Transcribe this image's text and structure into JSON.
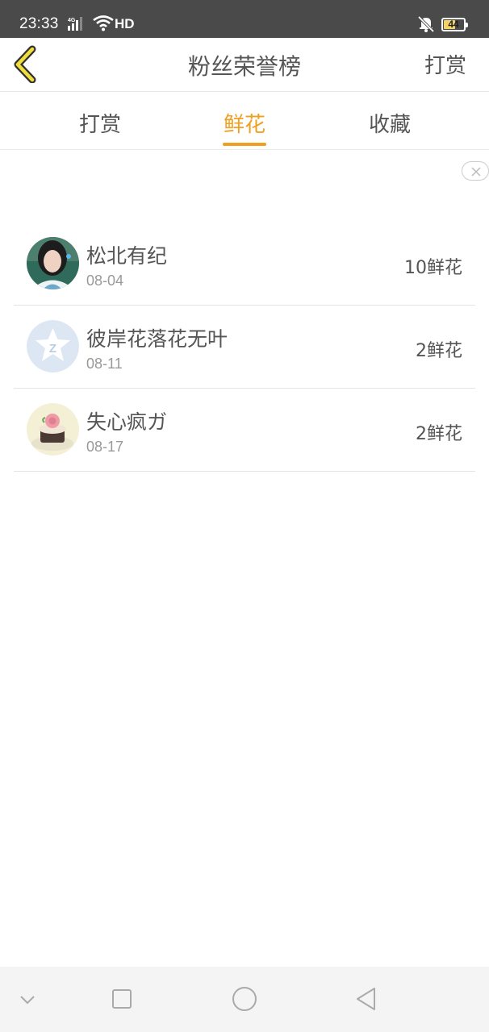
{
  "status_bar": {
    "time": "23:33",
    "network": "4G",
    "hd_label": "HD",
    "battery": "44",
    "icons": [
      "signal-icon",
      "wifi-icon",
      "mute-bell-icon",
      "battery-icon"
    ]
  },
  "header": {
    "back_icon": "chevron-left-icon",
    "title": "粉丝荣誉榜",
    "action_label": "打赏"
  },
  "tabs": [
    {
      "label": "打赏",
      "active": false
    },
    {
      "label": "鲜花",
      "active": true
    },
    {
      "label": "收藏",
      "active": false
    }
  ],
  "accent_color": "#f0a020",
  "ad": {
    "close_icon": "close-icon"
  },
  "fans": [
    {
      "name": "松北有纪",
      "date": "08-04",
      "amount": "10鲜花",
      "avatar": "photo-avatar"
    },
    {
      "name": "彼岸花落花无叶",
      "date": "08-11",
      "amount": "2鲜花",
      "avatar": "default-qq-avatar"
    },
    {
      "name": "失心疯ガ",
      "date": "08-17",
      "amount": "2鲜花",
      "avatar": "cupcake-avatar"
    }
  ],
  "nav_bar": {
    "icons": [
      "collapse-chevron-icon",
      "recents-square-icon",
      "home-circle-icon",
      "back-triangle-icon"
    ]
  }
}
